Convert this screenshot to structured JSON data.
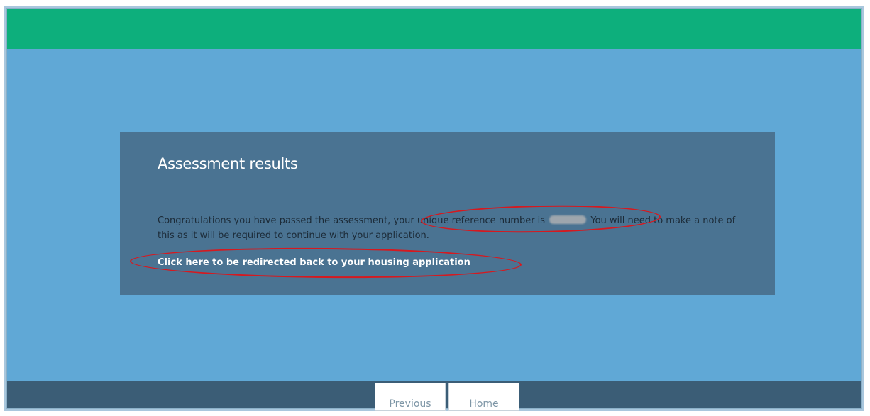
{
  "header": {
    "color": "#0daf7c"
  },
  "panel": {
    "title": "Assessment results",
    "message_part1": "Congratulations you have passed the assessment, your unique reference number is",
    "message_part2": "You will need to make a note of this as it will be required to continue with your application.",
    "link_text": "Click here to be redirected back to your housing application"
  },
  "annotations": {
    "color": "#d6191f"
  },
  "footer": {
    "previous_label": "Previous",
    "home_label": "Home"
  }
}
